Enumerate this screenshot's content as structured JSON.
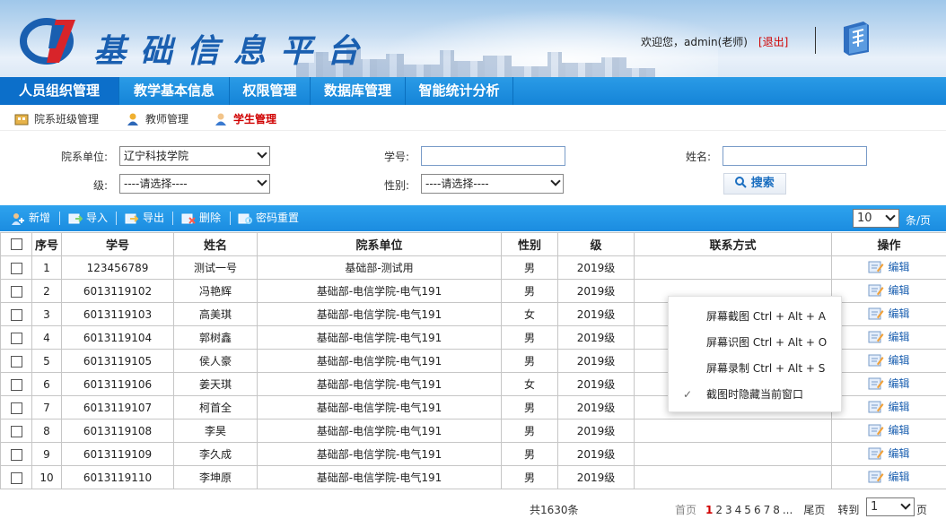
{
  "header": {
    "site_title": "基础信息平台",
    "welcome_text": "欢迎您，admin(老师)",
    "logout_label": "[退出]"
  },
  "nav": {
    "items": [
      {
        "label": "人员组织管理",
        "active": true
      },
      {
        "label": "教学基本信息",
        "active": false
      },
      {
        "label": "权限管理",
        "active": false
      },
      {
        "label": "数据库管理",
        "active": false
      },
      {
        "label": "智能统计分析",
        "active": false
      }
    ]
  },
  "subnav": {
    "items": [
      {
        "label": "院系班级管理",
        "icon": "building-icon",
        "active": false
      },
      {
        "label": "教师管理",
        "icon": "teacher-icon",
        "active": false
      },
      {
        "label": "学生管理",
        "icon": "student-icon",
        "active": true
      }
    ]
  },
  "search": {
    "dept_label": "院系单位:",
    "dept_value": "辽宁科技学院",
    "student_no_label": "学号:",
    "student_no_value": "",
    "name_label": "姓名:",
    "name_value": "",
    "grade_label": "级:",
    "grade_value": "----请选择----",
    "gender_label": "性别:",
    "gender_value": "----请选择----",
    "search_label": "搜索"
  },
  "toolbar": {
    "add_label": "新增",
    "import_label": "导入",
    "export_label": "导出",
    "delete_label": "删除",
    "reset_pwd_label": "密码重置",
    "page_size": "10",
    "page_size_unit": "条/页"
  },
  "table": {
    "headers": [
      "序号",
      "学号",
      "姓名",
      "院系单位",
      "性别",
      "级",
      "联系方式",
      "操作"
    ],
    "edit_label": "编辑",
    "rows": [
      {
        "idx": "1",
        "no": "123456789",
        "name": "测试一号",
        "dept": "基础部-测试用",
        "gender": "男",
        "grade": "2019级",
        "contact": ""
      },
      {
        "idx": "2",
        "no": "6013119102",
        "name": "冯艳辉",
        "dept": "基础部-电信学院-电气191",
        "gender": "男",
        "grade": "2019级",
        "contact": ""
      },
      {
        "idx": "3",
        "no": "6013119103",
        "name": "高美琪",
        "dept": "基础部-电信学院-电气191",
        "gender": "女",
        "grade": "2019级",
        "contact": ""
      },
      {
        "idx": "4",
        "no": "6013119104",
        "name": "郭树鑫",
        "dept": "基础部-电信学院-电气191",
        "gender": "男",
        "grade": "2019级",
        "contact": ""
      },
      {
        "idx": "5",
        "no": "6013119105",
        "name": "侯人豪",
        "dept": "基础部-电信学院-电气191",
        "gender": "男",
        "grade": "2019级",
        "contact": ""
      },
      {
        "idx": "6",
        "no": "6013119106",
        "name": "姜天琪",
        "dept": "基础部-电信学院-电气191",
        "gender": "女",
        "grade": "2019级",
        "contact": ""
      },
      {
        "idx": "7",
        "no": "6013119107",
        "name": "柯首全",
        "dept": "基础部-电信学院-电气191",
        "gender": "男",
        "grade": "2019级",
        "contact": ""
      },
      {
        "idx": "8",
        "no": "6013119108",
        "name": "李昊",
        "dept": "基础部-电信学院-电气191",
        "gender": "男",
        "grade": "2019级",
        "contact": ""
      },
      {
        "idx": "9",
        "no": "6013119109",
        "name": "李久成",
        "dept": "基础部-电信学院-电气191",
        "gender": "男",
        "grade": "2019级",
        "contact": ""
      },
      {
        "idx": "10",
        "no": "6013119110",
        "name": "李坤原",
        "dept": "基础部-电信学院-电气191",
        "gender": "男",
        "grade": "2019级",
        "contact": ""
      }
    ]
  },
  "context_menu": {
    "items": [
      {
        "label": "屏幕截图 Ctrl + Alt + A",
        "checked": false
      },
      {
        "label": "屏幕识图 Ctrl + Alt + O",
        "checked": false
      },
      {
        "label": "屏幕录制 Ctrl + Alt + S",
        "checked": false
      },
      {
        "label": "截图时隐藏当前窗口",
        "checked": true
      }
    ],
    "check_mark": "✓"
  },
  "pager": {
    "total": "共1630条",
    "first": "首页",
    "pages": [
      "1",
      "2",
      "3",
      "4",
      "5",
      "6",
      "7",
      "8"
    ],
    "current": "1",
    "ellipsis": "...",
    "last": "尾页",
    "goto_label": "转到",
    "goto_value": "1",
    "page_unit": "页"
  },
  "colors": {
    "nav_bg": "#1584d8",
    "accent_red": "#d00000",
    "brand_blue": "#1a5fb0"
  }
}
